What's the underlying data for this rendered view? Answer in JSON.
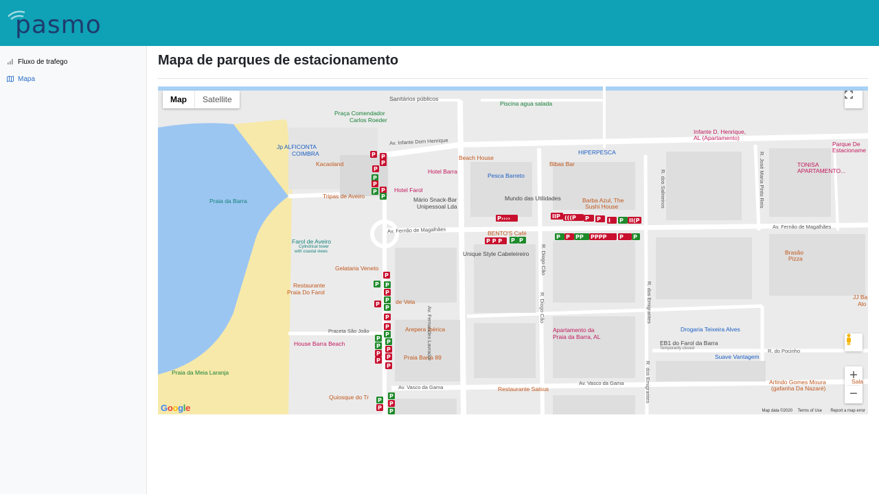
{
  "brand": {
    "logo_text": "pasmo",
    "colors": {
      "header": "#0fa1b5",
      "logo": "#1d3c6e"
    }
  },
  "sidebar": {
    "items": [
      {
        "label": "Fluxo de trafego",
        "icon": "bar-chart-icon",
        "active": false
      },
      {
        "label": "Mapa",
        "icon": "map-icon",
        "active": true
      }
    ]
  },
  "page": {
    "title": "Mapa de parques de estacionamento"
  },
  "map": {
    "type_buttons": {
      "map": "Map",
      "satellite": "Satellite"
    },
    "selected_type": "Map",
    "places": {
      "sanitarios": "Sanitários públicos",
      "piscina": "Piscina agua salada",
      "praca1": "Praça Comendador",
      "praca2": "Carlos Roeder",
      "jp1": "Jp ALFICONTA",
      "jp2": "COIMBRA",
      "kaca": "Kacaoland",
      "beach_house": "Beach House",
      "hiperpesca": "HIPERPESCA",
      "infante1": "Infante D. Henrique,",
      "infante2": "AL (Apartamento)",
      "parque1": "Parque De",
      "parque2": "Estacioname",
      "tonisa1": "TONISA",
      "tonisa2": "APARTAMENTO...",
      "hotel_barra": "Hotel Barra",
      "bibas": "Bibas Bar",
      "pesca_barreto": "Pesca Barreto",
      "praia_barra": "Praia da Barra",
      "tripas": "Tripas de Aveiro",
      "hotel_farol": "Hotel Farol",
      "marito1": "Mário Snack-Bar",
      "marito2": "Unipessoal Lda",
      "mundo": "Mundo das Utilidades",
      "barba1": "Barba Azul, The",
      "barba2": "Sushi House",
      "farol1": "Farol de Aveiro",
      "farol2": "Cylindrical tower",
      "farol3": "with coastal views",
      "bentos": "BENTO'S Café",
      "unique": "Unique Style Cabeleireiro",
      "brasao1": "Brasão",
      "brasao2": "Pizza",
      "gelataria": "Gelataria Veneto",
      "restaurante1": "Restaurante",
      "restaurante2": "Praia Do Farol",
      "de_vela": "de Vela",
      "jj": "JJ Ba",
      "alo": "Alo",
      "arepera": "Arepera Ibérica",
      "apartamento1": "Apartamento da",
      "apartamento2": "Praia da Barra, AL",
      "drogaria": "Drogaria Teixeira Alves",
      "eb1_1": "EB1 do Farol da Barra",
      "eb1_2": "Temporarily closed",
      "suave": "Suave Vantagem",
      "house_beach": "House Barra Beach",
      "praia89": "Praia Barra 89",
      "meia_laranja": "Praia da Meia Laranja",
      "quiosque": "Quiosque do Tr",
      "salsus": "Restaurante Salsus",
      "arlindo1": "Arlindo Gomes Moura",
      "arlindo2": "(gafanha Da Nazaré)",
      "sala": "Sala"
    },
    "roads": {
      "infante": "Av. Infante Dom Henrique",
      "fernao": "Av. Fernão de Magalhães",
      "fernao2": "Av. Fernão de Magalhães",
      "fernandes": "Av. Fernandes Lavrador",
      "diogo": "R. Diogo Cão",
      "diogo2": "R. Diogo Cão",
      "emigrantes": "R. dos Emigrantes",
      "emigrantes2": "R. dos Emigrantes",
      "salineiros": "R. dos Salineiros",
      "jose_maria": "R. José Maria Pinto Reis",
      "pocinho": "R. do Pocinho",
      "vasco": "Av. Vasco da Gama",
      "vasco2": "Av. Vasco da Gama",
      "praceta": "Praceta São João"
    },
    "footer": {
      "google": "Google",
      "map_data": "Map data ©2020",
      "terms": "Terms of Use",
      "report": "Report a map error"
    },
    "parking_colors": {
      "occupied": "#c8102e",
      "free": "#1e8a2a"
    }
  }
}
